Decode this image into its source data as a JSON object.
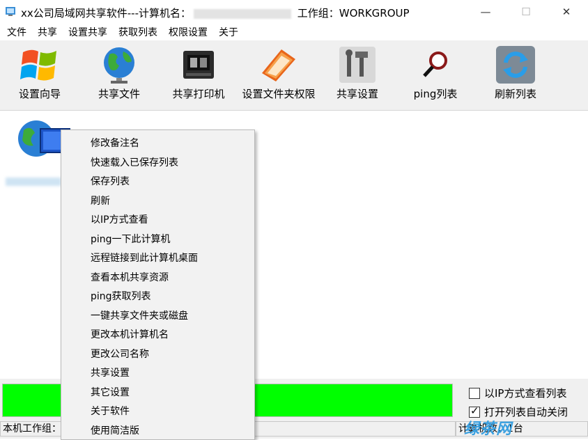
{
  "window": {
    "title_prefix": "xx公司局域网共享软件---计算机名：",
    "title_suffix": " 工作组：WORKGROUP",
    "minimize_glyph": "—",
    "maximize_glyph": "☐",
    "close_glyph": "✕"
  },
  "menu": [
    "文件",
    "共享",
    "设置共享",
    "获取列表",
    "权限设置",
    "关于"
  ],
  "toolbar": [
    {
      "label": "设置向导",
      "icon": "windows-flag-icon"
    },
    {
      "label": "共享文件",
      "icon": "globe-icon"
    },
    {
      "label": "共享打印机",
      "icon": "printer-icon"
    },
    {
      "label": "设置文件夹权限",
      "icon": "folder-book-icon"
    },
    {
      "label": "共享设置",
      "icon": "tools-icon"
    },
    {
      "label": "ping列表",
      "icon": "magnifier-icon"
    },
    {
      "label": "刷新列表",
      "icon": "refresh-icon"
    }
  ],
  "context_menu": [
    "修改备注名",
    "快速载入已保存列表",
    "保存列表",
    "刷新",
    "以IP方式查看",
    "ping一下此计算机",
    "远程链接到此计算机桌面",
    "查看本机共享资源",
    "ping获取列表",
    "一键共享文件夹或磁盘",
    "更改本机计算机名",
    "更改公司名称",
    "共享设置",
    "其它设置",
    "关于软件",
    "使用简洁版"
  ],
  "options": {
    "view_by_ip_label": "以IP方式查看列表",
    "view_by_ip_checked": false,
    "auto_close_label": "打开列表自动关闭",
    "auto_close_checked": true
  },
  "progress": {
    "fraction": 1.0,
    "color": "#00ff00"
  },
  "status": {
    "left": "本机工作组：",
    "right": "计算机数：1台"
  },
  "watermark": "绿茶网"
}
